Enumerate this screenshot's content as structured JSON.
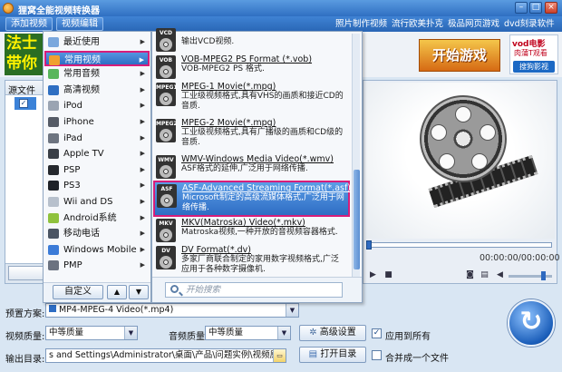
{
  "window": {
    "title": "狸窝全能视频转换器"
  },
  "topbar": {
    "add_video": "添加视频",
    "video_edit": "视频编辑",
    "links": [
      "照片制作视频",
      "流行欧美扑克",
      "极品网页游戏",
      "dvd刻录软件"
    ]
  },
  "ads": {
    "left_text_1": "法士",
    "left_text_2": "带你",
    "game": "开始游戏",
    "vod_title": "vod电影",
    "vod_sub": "肉蒲T观看",
    "vod_button": "搜狗影视"
  },
  "filelist": {
    "header": "源文件"
  },
  "menu": {
    "items": [
      {
        "label": "最近使用",
        "icon": "clock-icon",
        "color": "#7aa7dd",
        "arrow": true
      },
      {
        "label": "常用视频",
        "icon": "film-icon",
        "color": "#f0a030",
        "arrow": true,
        "selected": true
      },
      {
        "label": "常用音频",
        "icon": "music-icon",
        "color": "#58b65c",
        "arrow": true
      },
      {
        "label": "高清视频",
        "icon": "hd-icon",
        "color": "#2f6fc2",
        "arrow": true
      },
      {
        "label": "iPod",
        "icon": "ipod-icon",
        "color": "#9aa4b2",
        "arrow": true
      },
      {
        "label": "iPhone",
        "icon": "iphone-icon",
        "color": "#555b66",
        "arrow": true
      },
      {
        "label": "iPad",
        "icon": "ipad-icon",
        "color": "#6d7480",
        "arrow": true
      },
      {
        "label": "Apple TV",
        "icon": "appletv-icon",
        "color": "#3a3f47",
        "arrow": true
      },
      {
        "label": "PSP",
        "icon": "psp-icon",
        "color": "#25282e",
        "arrow": true
      },
      {
        "label": "PS3",
        "icon": "ps3-icon",
        "color": "#1f2228",
        "arrow": true
      },
      {
        "label": "Wii and DS",
        "icon": "wii-icon",
        "color": "#b7c0cc",
        "arrow": true
      },
      {
        "label": "Android系统",
        "icon": "android-icon",
        "color": "#8fc23d",
        "arrow": true
      },
      {
        "label": "移动电话",
        "icon": "phone-icon",
        "color": "#4b5563",
        "arrow": true
      },
      {
        "label": "Windows Mobile",
        "icon": "windows-icon",
        "color": "#3b7bd8",
        "arrow": true
      },
      {
        "label": "PMP",
        "icon": "pmp-icon",
        "color": "#6b7280",
        "arrow": true
      }
    ],
    "customize": "自定义"
  },
  "formats": {
    "items": [
      {
        "badge": "VCD",
        "name": "",
        "desc": "输出VCD视频."
      },
      {
        "badge": "VOB",
        "name": "VOB-MPEG2 PS Format (*.vob)",
        "desc": "VOB-MPEG2 PS 格式."
      },
      {
        "badge": "MPEG1",
        "name": "MPEG-1 Movie(*.mpg)",
        "desc": "工业级视频格式,具有VHS的画质和接近CD的音质."
      },
      {
        "badge": "MPEG2",
        "name": "MPEG-2 Movie(*.mpg)",
        "desc": "工业级视频格式,具有广播级的画质和CD级的音质."
      },
      {
        "badge": "WMV",
        "name": "WMV-Windows Media Video(*.wmv)",
        "desc": "ASF格式的延伸,广泛用于网络传播."
      },
      {
        "badge": "ASF",
        "name": "ASF-Advanced Streaming Format(*.asf)",
        "desc": "Microsoft制定的高级流媒体格式,广泛用于网络传播.",
        "selected": true
      },
      {
        "badge": "MKV",
        "name": "MKV(Matroska) Video(*.mkv)",
        "desc": "Matroska视频,一种开放的音视频容器格式."
      },
      {
        "badge": "DV",
        "name": "DV Format(*.dv)",
        "desc": "多家厂商联合制定的家用数字视频格式,广泛应用于各种数字摄像机."
      }
    ],
    "search_placeholder": "开始搜索"
  },
  "preview": {
    "time": "00:00:00/00:00:00"
  },
  "settings": {
    "preset_label": "预置方案:",
    "preset_value": "MP4-MPEG-4 Video(*.mp4)",
    "video_quality_label": "视频质量:",
    "video_quality_value": "中等质量",
    "audio_quality_label": "音频质量:",
    "audio_quality_value": "中等质量",
    "advanced_button": "高级设置",
    "apply_all_label": "应用到所有",
    "output_label": "输出目录:",
    "output_path": "s and Settings\\Administrator\\桌面\\产品\\问题实例\\视频原件\\转换",
    "open_dir_button": "打开目录",
    "merge_label": "合并成一个文件"
  },
  "colors": {
    "accent": "#2e6dc4",
    "highlight_border": "#d71d7a"
  }
}
